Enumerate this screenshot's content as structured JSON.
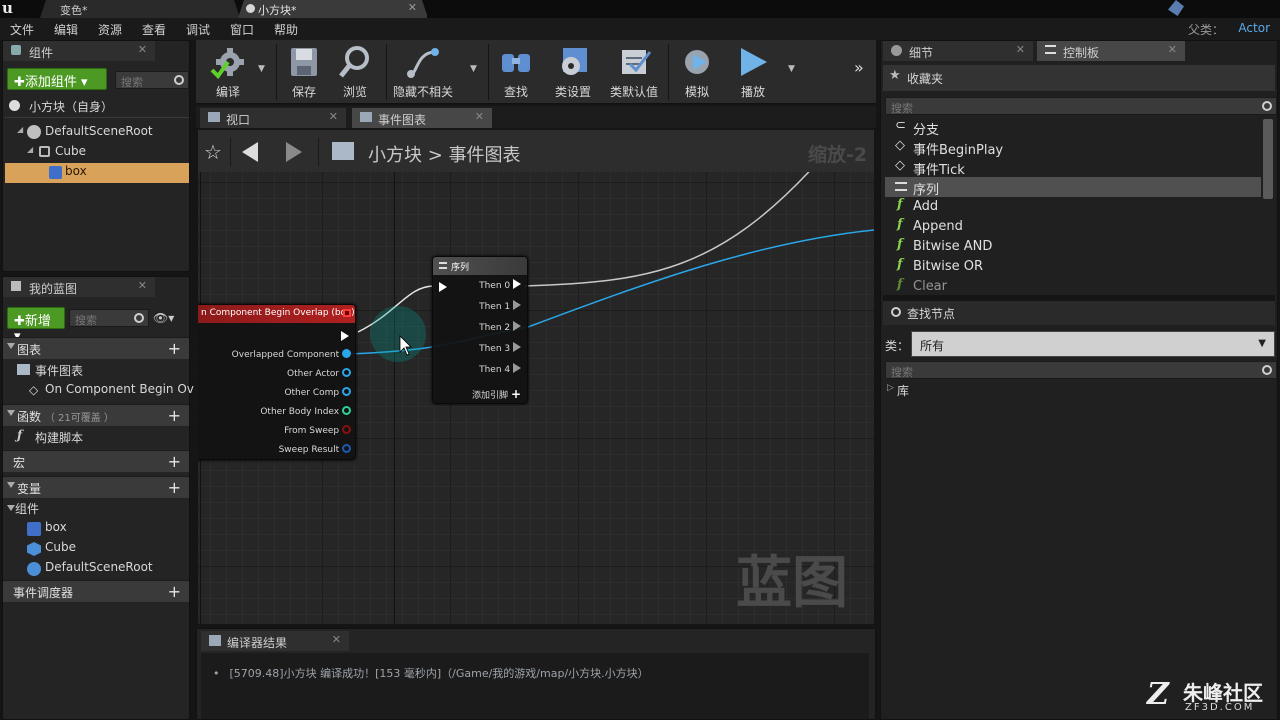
{
  "titlebar": {
    "tabs": [
      {
        "label": "变色*",
        "active": false
      },
      {
        "label": "小方块*",
        "active": true
      }
    ]
  },
  "menubar": {
    "items": [
      "文件",
      "编辑",
      "资源",
      "查看",
      "调试",
      "窗口",
      "帮助"
    ],
    "parent_label": "父类：",
    "parent_value": "Actor"
  },
  "components_panel": {
    "tab": "组件",
    "add_button": "✚添加组件 ▾",
    "search_placeholder": "搜索",
    "self_label": "小方块（自身）",
    "tree": [
      {
        "label": "DefaultSceneRoot",
        "icon": "scene-root-icon"
      },
      {
        "label": "Cube",
        "icon": "cube-icon"
      },
      {
        "label": "box",
        "icon": "box-icon",
        "selected": true
      }
    ]
  },
  "my_blueprint": {
    "tab": "我的蓝图",
    "new_button": "✚新增 ▾",
    "search_placeholder": "搜索",
    "sections": {
      "graphs": "图表",
      "event_graph": "事件图表",
      "event_item": "On Component Begin Ov",
      "functions": "函数",
      "functions_hint": "（ 21可覆盖 ）",
      "construct": "构建脚本",
      "macros": "宏",
      "variables": "变量",
      "components": "组件",
      "var_items": [
        "box",
        "Cube",
        "DefaultSceneRoot"
      ],
      "dispatchers": "事件调度器"
    }
  },
  "toolbar": {
    "buttons": [
      {
        "label": "编译",
        "icon": "compile-icon"
      },
      {
        "label": "保存",
        "icon": "save-icon"
      },
      {
        "label": "浏览",
        "icon": "browse-icon"
      },
      {
        "label": "隐藏不相关",
        "icon": "hide-unrelated-icon"
      },
      {
        "label": "查找",
        "icon": "find-icon"
      },
      {
        "label": "类设置",
        "icon": "class-settings-icon"
      },
      {
        "label": "类默认值",
        "icon": "class-defaults-icon"
      },
      {
        "label": "模拟",
        "icon": "simulate-icon"
      },
      {
        "label": "播放",
        "icon": "play-icon"
      }
    ]
  },
  "editor_tabs": [
    {
      "label": "视口",
      "active": false
    },
    {
      "label": "事件图表",
      "active": true
    }
  ],
  "breadcrumb": {
    "root": "小方块",
    "separator": ">",
    "current": "事件图表",
    "zoom": "缩放-2"
  },
  "nodes": {
    "overlap": {
      "title": "n Component Begin Overlap (box)",
      "pins": [
        "Overlapped Component",
        "Other Actor",
        "Other Comp",
        "Other Body Index",
        "From Sweep",
        "Sweep Result"
      ]
    },
    "sequence": {
      "title": "序列",
      "pins": [
        "Then 0",
        "Then 1",
        "Then 2",
        "Then 3",
        "Then 4"
      ],
      "add_pin": "添加引脚"
    }
  },
  "graph_watermark": "蓝图",
  "compiler": {
    "tab": "编译器结果",
    "message": "[5709.48]小方块 编译成功！[153 毫秒内]（/Game/我的游戏/map/小方块.小方块）"
  },
  "details_tab": "细节",
  "palette": {
    "tab": "控制板",
    "favorites": "收藏夹",
    "search_placeholder": "搜索",
    "items": [
      {
        "label": "分支",
        "icon": "branch-icon"
      },
      {
        "label": "事件BeginPlay",
        "icon": "event-icon"
      },
      {
        "label": "事件Tick",
        "icon": "event-icon"
      },
      {
        "label": "序列",
        "icon": "sequence-icon",
        "selected": true
      },
      {
        "label": "Add",
        "icon": "function-icon"
      },
      {
        "label": "Append",
        "icon": "function-icon"
      },
      {
        "label": "Bitwise AND",
        "icon": "function-icon"
      },
      {
        "label": "Bitwise OR",
        "icon": "function-icon"
      },
      {
        "label": "Clear",
        "icon": "function-icon"
      }
    ],
    "find_node": "查找节点",
    "category_label": "类：",
    "category_value": "所有",
    "search2_placeholder": "搜索",
    "library": "库"
  },
  "brand": {
    "name": "朱峰社区",
    "url": "ZF3D.COM"
  }
}
